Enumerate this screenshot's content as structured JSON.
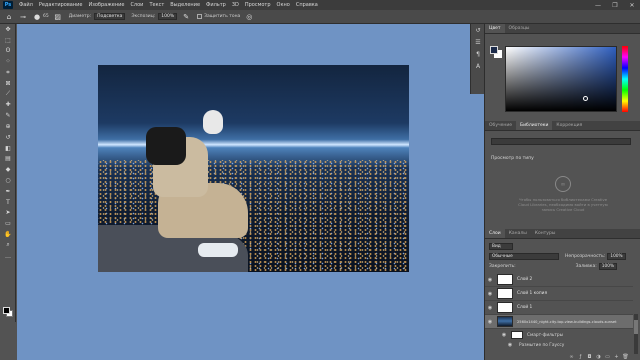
{
  "menubar": {
    "logo": "Ps",
    "items": [
      "Файл",
      "Редактирование",
      "Изображение",
      "Слои",
      "Текст",
      "Выделение",
      "Фильтр",
      "3D",
      "Просмотр",
      "Окно",
      "Справка"
    ],
    "window_controls": [
      "—",
      "❐",
      "✕"
    ]
  },
  "options": {
    "brush_size": "65",
    "diameter_label": "Диаметр:",
    "diameter_value": "Подсветка",
    "exposure_label": "Экспозиц:",
    "exposure_value": "100%",
    "protect_label": "Защитить тона"
  },
  "tools": [
    "move",
    "marquee",
    "lasso",
    "quick-select",
    "crop",
    "frame",
    "eyedropper",
    "healing",
    "brush",
    "clone",
    "history-brush",
    "eraser",
    "gradient",
    "blur",
    "dodge",
    "pen",
    "type",
    "path-select",
    "rectangle",
    "hand",
    "zoom",
    "more"
  ],
  "color_panel": {
    "tabs": [
      "Цвет",
      "Образцы"
    ],
    "fg_color": "#1c2b4a",
    "bg_color": "#ffffff"
  },
  "library_panel": {
    "tabs": [
      "Обучение",
      "Библиотеки",
      "Коррекция"
    ],
    "view_label": "Просмотр по типу",
    "message": "Чтобы пользоваться библиотеками Creative Cloud Libraries, необходимо войти в учетную запись Creative Cloud"
  },
  "layers_panel": {
    "tabs": [
      "Слои",
      "Каналы",
      "Контуры"
    ],
    "kind_filter": "Вид",
    "blend_mode": "Обычные",
    "opacity_label": "Непрозрачность:",
    "opacity_value": "100%",
    "lock_label": "Закрепить:",
    "fill_label": "Заливка:",
    "fill_value": "100%",
    "layers": [
      {
        "name": "Слой 2",
        "selected": false
      },
      {
        "name": "Слой 1 копия",
        "selected": false
      },
      {
        "name": "Слой 1",
        "selected": false
      },
      {
        "name": "2560x1440_night-city-top-view-buildings-clouds-sunset",
        "selected": true
      }
    ],
    "smart_filters": "Смарт-фильтры",
    "filter_name": "Размытие по Гауссу"
  }
}
